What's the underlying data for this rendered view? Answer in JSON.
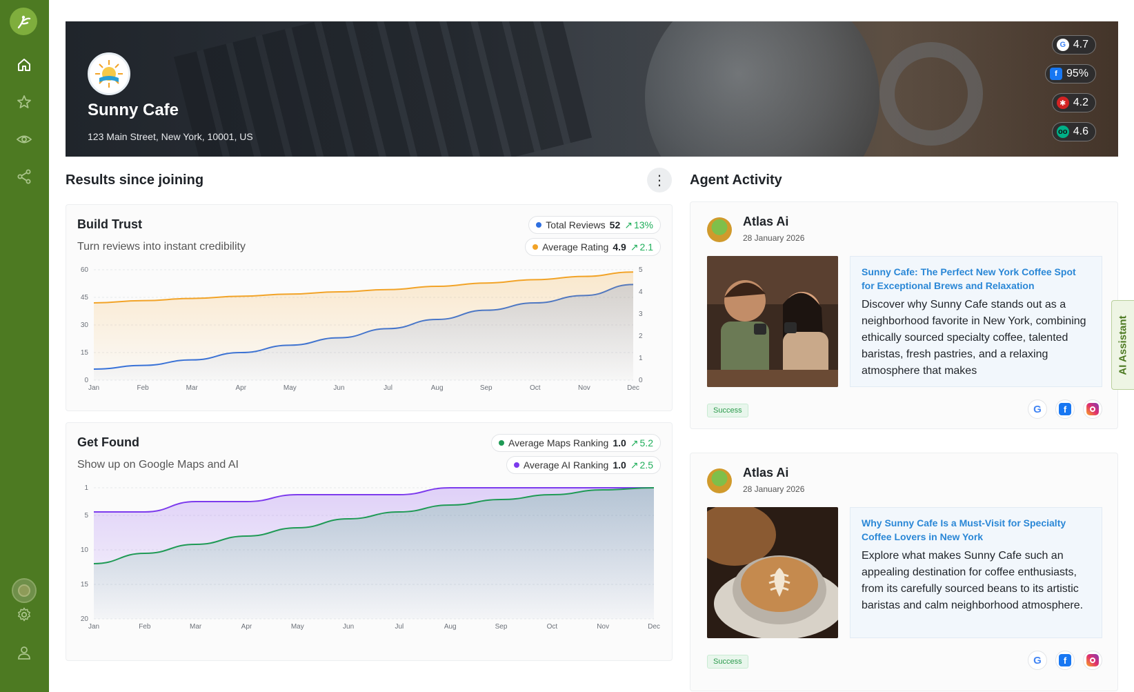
{
  "business": {
    "name": "Sunny Cafe",
    "address": "123 Main Street, New York, 10001, US"
  },
  "ratings": [
    {
      "platform": "google",
      "value": "4.7",
      "color": "#4285F4"
    },
    {
      "platform": "facebook",
      "value": "95%",
      "color": "#1877F2"
    },
    {
      "platform": "yelp",
      "value": "4.2",
      "color": "#D32323"
    },
    {
      "platform": "tripadvisor",
      "value": "4.6",
      "color": "#00AF87"
    }
  ],
  "sections": {
    "results_title": "Results since joining",
    "activity_title": "Agent Activity"
  },
  "build_trust": {
    "title": "Build Trust",
    "subtitle": "Turn reviews into instant credibility",
    "metrics": [
      {
        "label": "Total Reviews",
        "value": "52",
        "delta": "13%",
        "color": "#2f6fe0"
      },
      {
        "label": "Average Rating",
        "value": "4.9",
        "delta": "2.1",
        "color": "#f2a327"
      }
    ]
  },
  "get_found": {
    "title": "Get Found",
    "subtitle": "Show up on Google Maps and AI",
    "metrics": [
      {
        "label": "Average Maps Ranking",
        "value": "1.0",
        "delta": "5.2",
        "color": "#1f9a55"
      },
      {
        "label": "Average AI Ranking",
        "value": "1.0",
        "delta": "2.5",
        "color": "#7c3aed"
      }
    ]
  },
  "chart_data": [
    {
      "type": "area",
      "categories": [
        "Jan",
        "Feb",
        "Mar",
        "Apr",
        "May",
        "Jun",
        "Jul",
        "Aug",
        "Sep",
        "Oct",
        "Nov",
        "Dec"
      ],
      "y_left": {
        "ticks": [
          0,
          15,
          30,
          45,
          60
        ],
        "range": [
          0,
          60
        ]
      },
      "y_right": {
        "ticks": [
          0,
          1,
          2,
          3,
          4,
          5
        ],
        "range": [
          0,
          5
        ]
      },
      "series": [
        {
          "name": "Total Reviews",
          "axis": "left",
          "color": "#2f6fe0",
          "values": [
            6,
            8,
            11,
            15,
            19,
            23,
            28,
            33,
            38,
            42,
            46,
            52
          ]
        },
        {
          "name": "Average Rating",
          "axis": "right",
          "color": "#f2a327",
          "values": [
            3.5,
            3.6,
            3.7,
            3.8,
            3.9,
            4.0,
            4.1,
            4.25,
            4.4,
            4.55,
            4.7,
            4.9
          ]
        }
      ]
    },
    {
      "type": "area",
      "categories": [
        "Jan",
        "Feb",
        "Mar",
        "Apr",
        "May",
        "Jun",
        "Jul",
        "Aug",
        "Sep",
        "Oct",
        "Nov",
        "Dec"
      ],
      "y_left": {
        "ticks": [
          1,
          5,
          10,
          15,
          20
        ],
        "range": [
          1,
          20
        ],
        "inverted": true
      },
      "series": [
        {
          "name": "Average AI Ranking",
          "color": "#7c3aed",
          "values": [
            4.5,
            4.5,
            3.0,
            3.0,
            2.0,
            2.0,
            2.0,
            1.0,
            1.0,
            1.0,
            1.0,
            1.0
          ]
        },
        {
          "name": "Average Maps Ranking",
          "color": "#1f9a55",
          "values": [
            12.0,
            10.5,
            9.2,
            8.0,
            6.8,
            5.5,
            4.5,
            3.5,
            2.7,
            2.0,
            1.3,
            1.0
          ]
        }
      ]
    }
  ],
  "activities": [
    {
      "agent": "Atlas Ai",
      "date": "28 January 2026",
      "post_title": "Sunny Cafe: The Perfect New York Coffee Spot for Exceptional Brews and Relaxation",
      "post_body": "Discover why Sunny Cafe stands out as a neighborhood favorite in New York, combining ethically sourced specialty coffee, talented baristas, fresh pastries, and a relaxing atmosphere that makes",
      "status": "Success"
    },
    {
      "agent": "Atlas Ai",
      "date": "28 January 2026",
      "post_title": "Why Sunny Cafe Is a Must-Visit for Specialty Coffee Lovers in New York",
      "post_body": "Explore what makes Sunny Cafe such an appealing destination for coffee enthusiasts, from its carefully sourced beans to its artistic baristas and calm neighborhood atmosphere.",
      "status": "Success"
    }
  ],
  "ai_assistant": {
    "label": "AI Assistant"
  },
  "theme": {
    "sidebar": "#4d7a22",
    "accent_link": "#2a87d6"
  }
}
